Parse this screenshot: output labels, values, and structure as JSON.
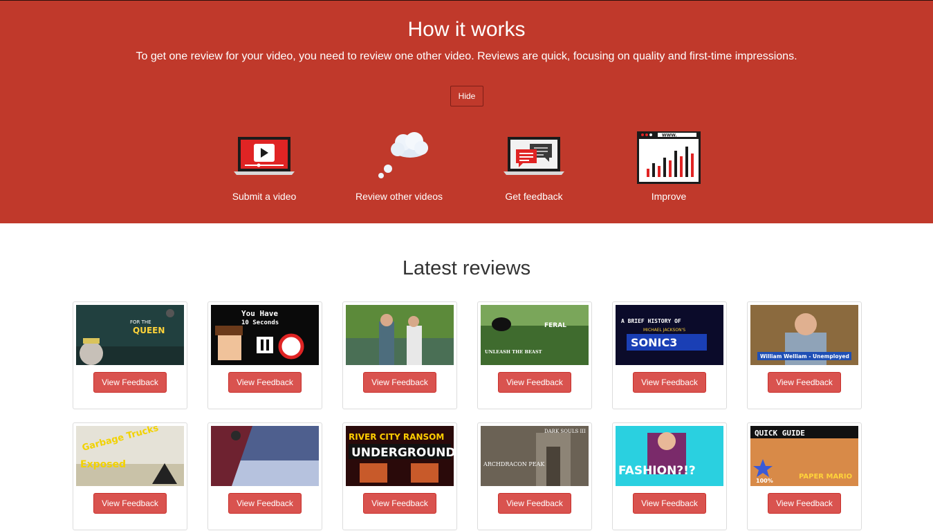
{
  "hero": {
    "title": "How it works",
    "subtitle": "To get one review for your video, you need to review one other video. Reviews are quick, focusing on quality and first-time impressions.",
    "hide_label": "Hide",
    "steps": [
      {
        "label": "Submit a video",
        "icon": "laptop-play-icon"
      },
      {
        "label": "Review other videos",
        "icon": "thought-cloud-icon"
      },
      {
        "label": "Get feedback",
        "icon": "laptop-chat-icon"
      },
      {
        "label": "Improve",
        "icon": "browser-chart-icon"
      }
    ]
  },
  "reviews": {
    "title": "Latest reviews",
    "button_label": "View Feedback",
    "items": [
      {
        "thumb_text": [
          "FOR THE",
          "QUEEN"
        ]
      },
      {
        "thumb_text": [
          "You Have",
          "10 Seconds"
        ]
      },
      {
        "thumb_text": []
      },
      {
        "thumb_text": [
          "FERAL",
          "UNLEASH THE BEAST"
        ]
      },
      {
        "thumb_text": [
          "A BRIEF HISTORY OF",
          "MICHAEL JACKSON'S",
          "SONIC3"
        ]
      },
      {
        "thumb_text": [
          "William Welliam - Unemployed"
        ]
      },
      {
        "thumb_text": [
          "Garbage Trucks",
          "Exposed"
        ]
      },
      {
        "thumb_text": []
      },
      {
        "thumb_text": [
          "RIVER CITY RANSOM",
          "UNDERGROUND"
        ]
      },
      {
        "thumb_text": [
          "DARK SOULS III",
          "ARCHDRACON PEAK"
        ]
      },
      {
        "thumb_text": [
          "FASHION?!?"
        ]
      },
      {
        "thumb_text": [
          "QUICK GUIDE",
          "PAPER MARIO",
          "100%"
        ]
      }
    ]
  },
  "colors": {
    "hero_bg": "#c0392b",
    "button": "#d9534f"
  }
}
